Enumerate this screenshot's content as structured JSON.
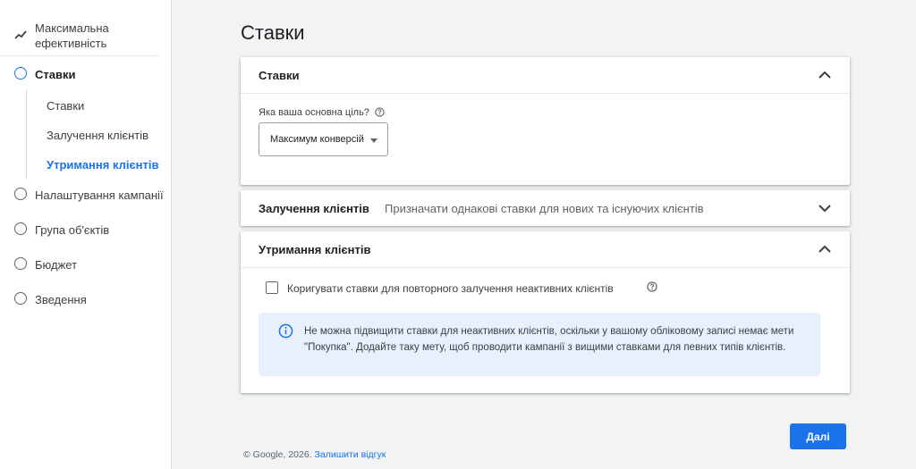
{
  "sidebar": {
    "top_item": {
      "label": "Максимальна ефективність",
      "icon": "trending-icon"
    },
    "steps": [
      {
        "label": "Ставки",
        "active": true
      },
      {
        "label": "Налаштування кампанії",
        "active": false
      },
      {
        "label": "Група об'єктів",
        "active": false
      },
      {
        "label": "Бюджет",
        "active": false
      },
      {
        "label": "Зведення",
        "active": false
      }
    ],
    "sub_items": [
      {
        "label": "Ставки",
        "active": false
      },
      {
        "label": "Залучення клієнтів",
        "active": false
      },
      {
        "label": "Утримання клієнтів",
        "active": true
      }
    ]
  },
  "page": {
    "title": "Ставки"
  },
  "bidding_card": {
    "title": "Ставки",
    "question": "Яка ваша основна ціль?",
    "select_value": "Максимум конверсій"
  },
  "acquisition_card": {
    "title": "Залучення клієнтів",
    "summary": "Призначати однакові ставки для нових та існуючих клієнтів"
  },
  "retention_card": {
    "title": "Утримання клієнтів",
    "checkbox_label": "Коригувати ставки для повторного залучення неактивних клієнтів",
    "checkbox_checked": false,
    "info_text": "Не можна підвищити ставки для неактивних клієнтів, оскільки у вашому обліковому записі немає мети \"Покупка\". Додайте таку мету, щоб проводити кампанії з вищими ставками для певних типів клієнтів."
  },
  "actions": {
    "next_label": "Далі"
  },
  "footer": {
    "copyright": "© Google, 2026.",
    "feedback_link": "Залишити відгук"
  },
  "colors": {
    "accent": "#1a73e8",
    "info_bg": "#e8f0fe"
  }
}
